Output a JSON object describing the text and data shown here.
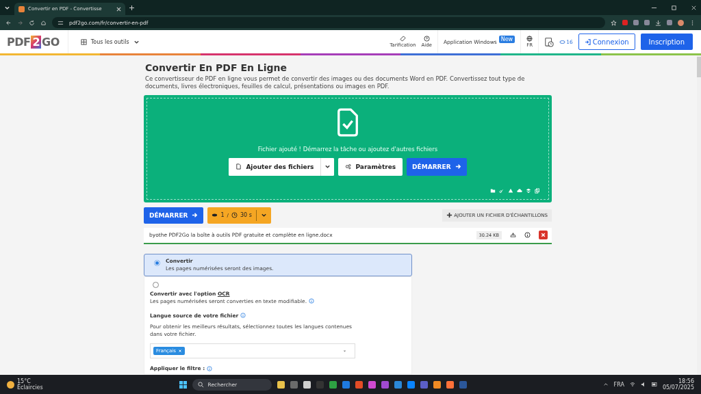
{
  "browser": {
    "tab_title": "Convertir en PDF - Convertisse",
    "url": "pdf2go.com/fr/convertir-en-pdf"
  },
  "header": {
    "logo": [
      "PDF",
      "2",
      "GO"
    ],
    "tools_menu": "Tous les outils",
    "pricing": "Tarification",
    "help": "Aide",
    "windows_app": "Application Windows",
    "windows_badge": "New",
    "language": "FR",
    "credits": "16",
    "login": "Connexion",
    "signup": "Inscription"
  },
  "page": {
    "title": "Convertir En PDF En Ligne",
    "description": "Ce convertisseur de PDF en ligne vous permet de convertir des images ou des documents Word en PDF. Convertissez tout type de documents, livres électroniques, feuilles de calcul, présentations ou images en PDF."
  },
  "upload": {
    "message": "Fichier ajouté ! Démarrez la tâche ou ajoutez d'autres fichiers",
    "add_files": "Ajouter des fichiers",
    "settings": "Paramètres",
    "start": "DÉMARRER"
  },
  "actions": {
    "start": "DÉMARRER",
    "files_count": "1",
    "separator": "/",
    "time": "30 s",
    "sample": "AJOUTER UN FICHIER D'ÉCHANTILLONS"
  },
  "file": {
    "name": "byothe PDF2Go la boîte à outils PDF gratuite et complète en ligne.docx",
    "size": "30.24 KB"
  },
  "options": [
    {
      "title": "Convertir",
      "description": "Les pages numérisées seront des images.",
      "selected": true
    },
    {
      "title": "Convertir avec l'option **OCR**",
      "description": "Les pages numérisées seront converties en texte modifiable.",
      "selected": false
    }
  ],
  "ocr": {
    "language_label": "Langue source de votre fichier",
    "language_hint": "Pour obtenir les meilleurs résultats, sélectionnez toutes les langues contenues dans votre fichier.",
    "languages": [
      "Français"
    ],
    "filter_label": "Appliquer le filtre :"
  },
  "taskbar": {
    "temperature": "15°C",
    "weather": "Éclaircies",
    "search": "Rechercher",
    "input_language": "FRA",
    "time": "18:56",
    "date": "05/07/2025"
  }
}
